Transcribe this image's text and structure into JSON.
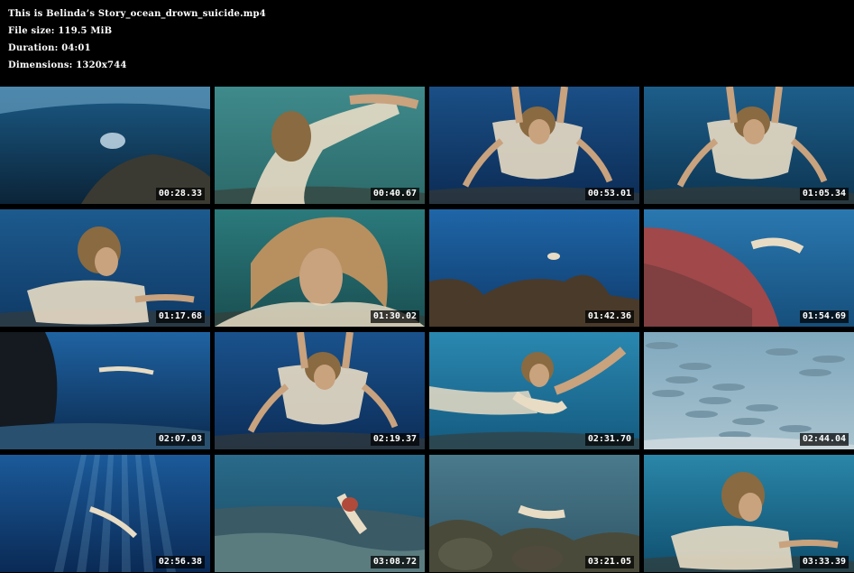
{
  "header": {
    "filename_line": "This is Belinda’s Story_ocean_drown_suicide.mp4",
    "filesize_line": "File size: 119.5 MiB",
    "duration_line": "Duration: 04:01",
    "dimensions_line": "Dimensions: 1320x744"
  },
  "thumbnails": [
    {
      "timestamp": "00:28.33",
      "scene": "surface-reef",
      "water": "#1b5a86",
      "deep": "#0b2438"
    },
    {
      "timestamp": "00:40.67",
      "scene": "swimmer-closeup",
      "water": "#3f8a8c",
      "deep": "#2c6a6a"
    },
    {
      "timestamp": "00:53.01",
      "scene": "swimmer-down",
      "water": "#1a4f86",
      "deep": "#0c2c55"
    },
    {
      "timestamp": "01:05.34",
      "scene": "swimmer-down",
      "water": "#1d5e8a",
      "deep": "#0d3552"
    },
    {
      "timestamp": "01:17.68",
      "scene": "swimmer-side",
      "water": "#1d5a8e",
      "deep": "#0f3a66"
    },
    {
      "timestamp": "01:30.02",
      "scene": "face-closeup",
      "water": "#2b7a7c",
      "deep": "#1a4f52"
    },
    {
      "timestamp": "01:42.36",
      "scene": "reef-distant",
      "water": "#1f66a8",
      "deep": "#0e3a6a"
    },
    {
      "timestamp": "01:54.69",
      "scene": "reef-coral",
      "water": "#2a78b0",
      "deep": "#164f7c"
    },
    {
      "timestamp": "02:07.03",
      "scene": "cave-distant",
      "water": "#1f63a2",
      "deep": "#0b2a4f"
    },
    {
      "timestamp": "02:19.37",
      "scene": "swimmer-down",
      "water": "#1a528c",
      "deep": "#0c2d58"
    },
    {
      "timestamp": "02:31.70",
      "scene": "swimmer-arms",
      "water": "#2a88b0",
      "deep": "#145a80"
    },
    {
      "timestamp": "02:44.04",
      "scene": "fish-school",
      "water": "#7fa8be",
      "deep": "#a9c3cf"
    },
    {
      "timestamp": "02:56.38",
      "scene": "sunrays-distant",
      "water": "#1b5a9a",
      "deep": "#0a2a55"
    },
    {
      "timestamp": "03:08.72",
      "scene": "seabed-swimmer",
      "water": "#2a6a8a",
      "deep": "#174a62"
    },
    {
      "timestamp": "03:21.05",
      "scene": "rocks-swimmer",
      "water": "#4a7a8c",
      "deep": "#2e5566"
    },
    {
      "timestamp": "03:33.39",
      "scene": "swimmer-side",
      "water": "#2a86a8",
      "deep": "#0f4e6e"
    }
  ],
  "colors": {
    "background": "#000000",
    "text": "#ffffff",
    "skin": "#c9a27e",
    "dress": "#e8dcc4",
    "hair": "#8a6a40",
    "rock": "#3a3a32",
    "coral": "#a0484a"
  }
}
